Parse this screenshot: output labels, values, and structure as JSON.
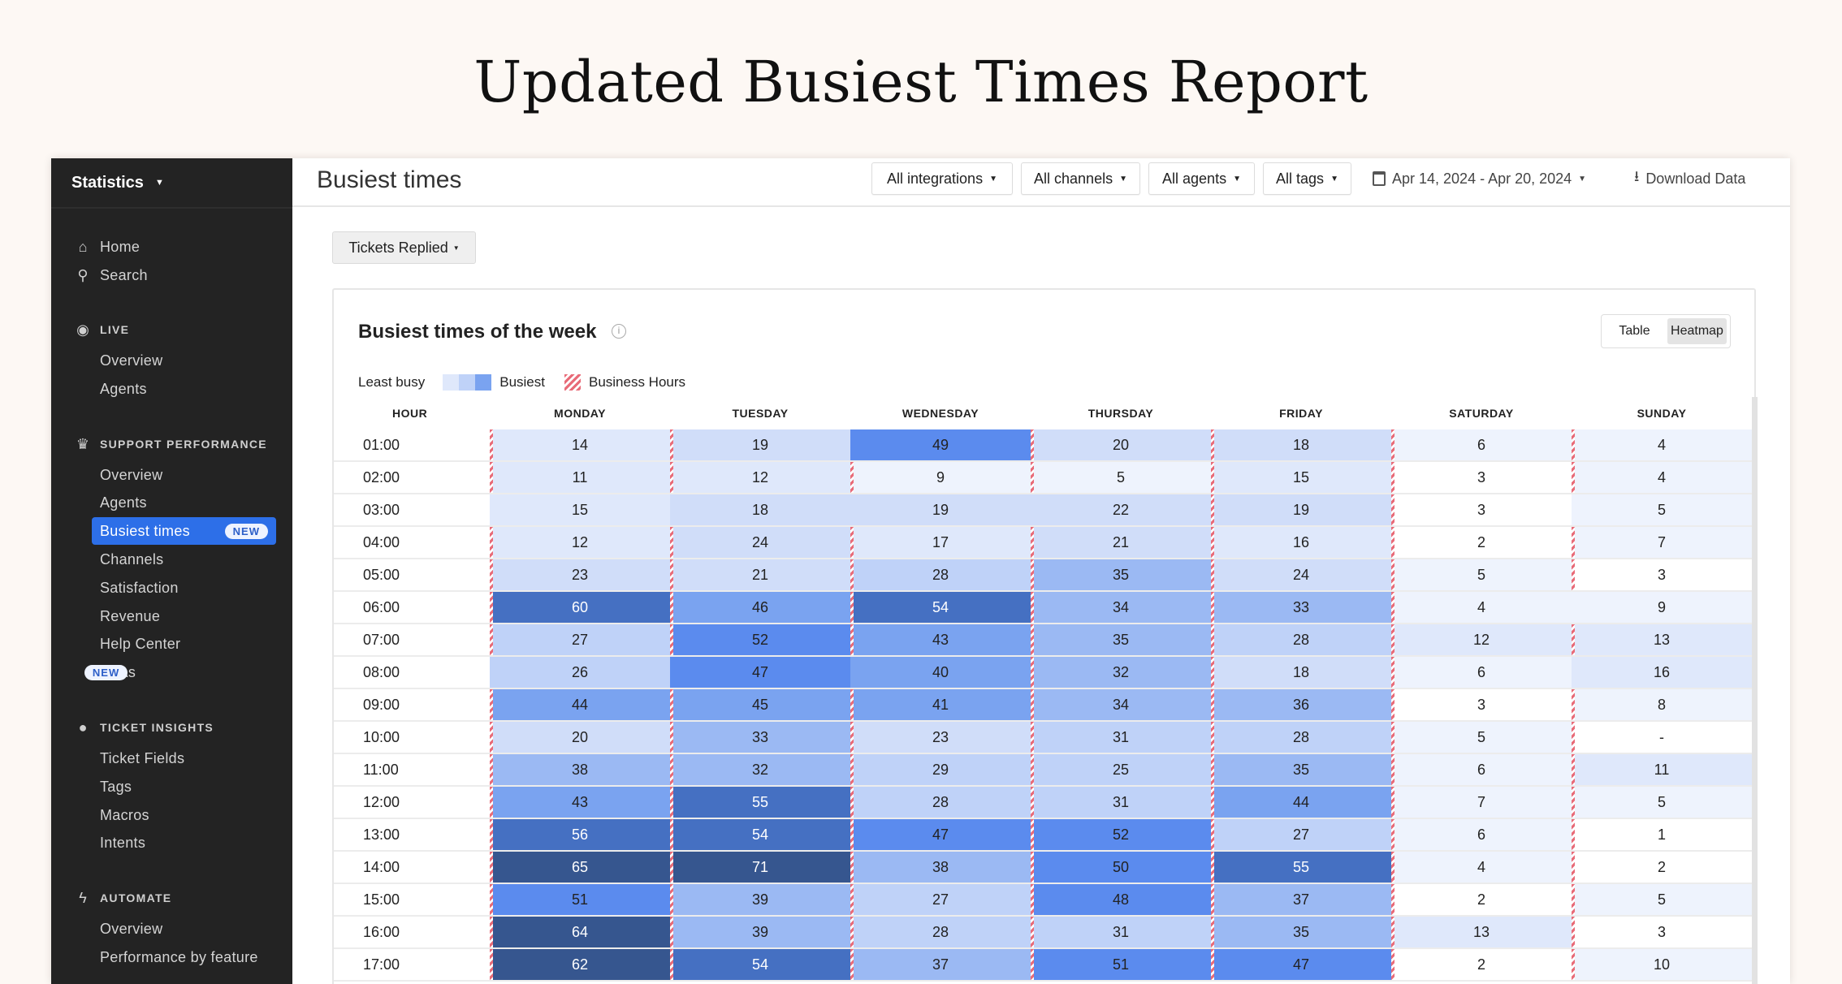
{
  "headline": "Updated Busiest Times Report",
  "sidebar": {
    "title": "Statistics",
    "top": [
      {
        "label": "Home",
        "icon": "home-icon"
      },
      {
        "label": "Search",
        "icon": "search-icon"
      }
    ],
    "sections": [
      {
        "label": "LIVE",
        "icon": "live-icon",
        "items": [
          "Overview",
          "Agents"
        ]
      },
      {
        "label": "SUPPORT PERFORMANCE",
        "icon": "trophy-icon",
        "items": [
          "Overview",
          "Agents",
          "Busiest times",
          "Channels",
          "Satisfaction",
          "Revenue",
          "Help Center",
          "SLAs"
        ]
      },
      {
        "label": "TICKET INSIGHTS",
        "icon": "lightbulb-icon",
        "items": [
          "Ticket Fields",
          "Tags",
          "Macros",
          "Intents"
        ]
      },
      {
        "label": "AUTOMATE",
        "icon": "bolt-icon",
        "items": [
          "Overview",
          "Performance by feature"
        ]
      }
    ],
    "active": "Busiest times",
    "badges": {
      "Busiest times": "NEW",
      "SLAs": "NEW"
    }
  },
  "header": {
    "title": "Busiest times",
    "filters": [
      "All integrations",
      "All channels",
      "All agents",
      "All tags"
    ],
    "date_range": "Apr 14, 2024 - Apr 20, 2024",
    "download": "Download Data"
  },
  "metric_select": "Tickets Replied",
  "card": {
    "title": "Busiest times of the week",
    "view_toggle": [
      "Table",
      "Heatmap"
    ],
    "active_view": "Heatmap",
    "legend": {
      "least": "Least busy",
      "most": "Busiest",
      "business_hours": "Business Hours"
    }
  },
  "accent": "#2d6fe8",
  "chart_data": {
    "type": "heatmap",
    "columns": [
      "HOUR",
      "MONDAY",
      "TUESDAY",
      "WEDNESDAY",
      "THURSDAY",
      "FRIDAY",
      "SATURDAY",
      "SUNDAY"
    ],
    "rows": [
      {
        "hour": "01:00",
        "values": [
          14,
          19,
          49,
          20,
          18,
          6,
          4
        ],
        "business_hours": [
          0,
          1,
          3,
          4,
          5,
          6
        ]
      },
      {
        "hour": "02:00",
        "values": [
          11,
          12,
          9,
          5,
          15,
          3,
          4
        ],
        "business_hours": [
          0,
          1,
          2,
          3,
          4,
          5,
          6
        ]
      },
      {
        "hour": "03:00",
        "values": [
          15,
          18,
          19,
          22,
          19,
          3,
          5
        ],
        "business_hours": [
          4,
          5
        ]
      },
      {
        "hour": "04:00",
        "values": [
          12,
          24,
          17,
          21,
          16,
          2,
          7
        ],
        "business_hours": [
          0,
          1,
          2,
          3,
          4,
          5,
          6
        ]
      },
      {
        "hour": "05:00",
        "values": [
          23,
          21,
          28,
          35,
          24,
          5,
          3
        ],
        "business_hours": [
          0,
          1,
          2,
          3,
          4,
          5,
          6
        ]
      },
      {
        "hour": "06:00",
        "values": [
          60,
          46,
          54,
          34,
          33,
          4,
          9
        ],
        "business_hours": [
          0,
          1,
          2,
          3,
          4,
          5
        ]
      },
      {
        "hour": "07:00",
        "values": [
          27,
          52,
          43,
          35,
          28,
          12,
          13
        ],
        "business_hours": [
          0,
          1,
          2,
          3,
          4,
          5,
          6
        ]
      },
      {
        "hour": "08:00",
        "values": [
          26,
          47,
          40,
          32,
          18,
          6,
          16
        ],
        "business_hours": [
          3,
          4,
          5
        ]
      },
      {
        "hour": "09:00",
        "values": [
          44,
          45,
          41,
          34,
          36,
          3,
          8
        ],
        "business_hours": [
          0,
          1,
          2,
          3,
          4,
          5,
          6
        ]
      },
      {
        "hour": "10:00",
        "values": [
          20,
          33,
          23,
          31,
          28,
          5,
          "-"
        ],
        "business_hours": [
          0,
          1,
          2,
          3,
          4,
          5,
          6
        ]
      },
      {
        "hour": "11:00",
        "values": [
          38,
          32,
          29,
          25,
          35,
          6,
          11
        ],
        "business_hours": [
          0,
          1,
          2,
          3,
          4,
          5,
          6
        ]
      },
      {
        "hour": "12:00",
        "values": [
          43,
          55,
          28,
          31,
          44,
          7,
          5
        ],
        "business_hours": [
          0,
          1,
          2,
          3,
          4,
          5,
          6
        ]
      },
      {
        "hour": "13:00",
        "values": [
          56,
          54,
          47,
          52,
          27,
          6,
          1
        ],
        "business_hours": [
          0,
          1,
          2,
          3,
          4,
          5,
          6
        ]
      },
      {
        "hour": "14:00",
        "values": [
          65,
          71,
          38,
          50,
          55,
          4,
          2
        ],
        "business_hours": [
          0,
          1,
          2,
          3,
          4,
          5,
          6
        ]
      },
      {
        "hour": "15:00",
        "values": [
          51,
          39,
          27,
          48,
          37,
          2,
          5
        ],
        "business_hours": [
          0,
          1,
          2,
          3,
          4,
          5,
          6
        ]
      },
      {
        "hour": "16:00",
        "values": [
          64,
          39,
          28,
          31,
          35,
          13,
          3
        ],
        "business_hours": [
          0,
          1,
          2,
          3,
          4,
          5,
          6
        ]
      },
      {
        "hour": "17:00",
        "values": [
          62,
          54,
          37,
          51,
          47,
          2,
          10
        ],
        "business_hours": [
          0,
          1,
          2,
          3,
          4,
          5,
          6
        ]
      }
    ],
    "color_scale": [
      "#ffffff",
      "#eef3fd",
      "#dfe8fb",
      "#d0ddf9",
      "#bfd2f8",
      "#9bb9f3",
      "#7aa3f0",
      "#5b8bee",
      "#4570c2",
      "#36568f"
    ],
    "hatch_color": "#e86b78"
  }
}
